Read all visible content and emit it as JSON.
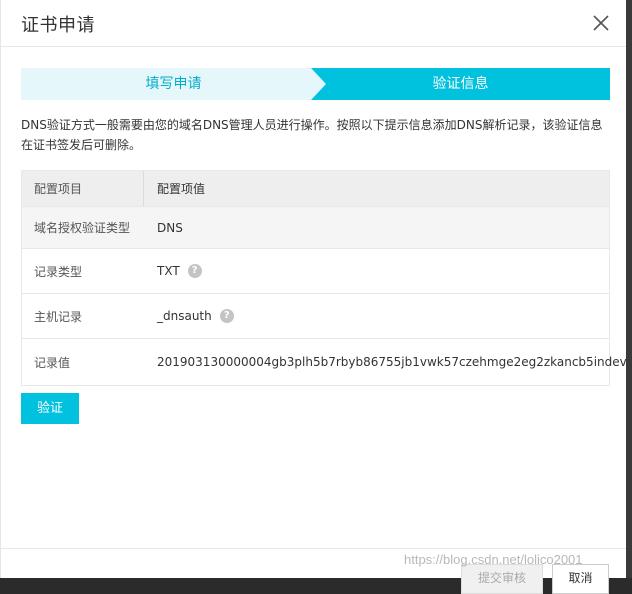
{
  "dialog": {
    "title": "证书申请"
  },
  "steps": [
    {
      "label": "填写申请",
      "active": false
    },
    {
      "label": "验证信息",
      "active": true
    }
  ],
  "description": "DNS验证方式一般需要由您的域名DNS管理人员进行操作。按照以下提示信息添加DNS解析记录，该验证信息在证书签发后可删除。",
  "table": {
    "headers": [
      "配置项目",
      "配置项值"
    ],
    "rows": [
      {
        "key": "域名授权验证类型",
        "value": "DNS",
        "help": false
      },
      {
        "key": "记录类型",
        "value": "TXT",
        "help": true
      },
      {
        "key": "主机记录",
        "value": "_dnsauth",
        "help": true
      },
      {
        "key": "记录值",
        "value": "201903130000004gb3plh5b7rbyb86755jb1vwk57czehmge2eg2zkancb5indev",
        "help": true
      }
    ],
    "help_glyph": "?"
  },
  "buttons": {
    "verify": "验证",
    "submit": "提交审核",
    "cancel": "取消"
  },
  "watermark": "https://blog.csdn.net/lolico2001",
  "colors": {
    "accent": "#00c1de",
    "step_active": "#00c1de",
    "step_inactive": "#e5f7fb",
    "step_inactive_text": "#00aecc"
  }
}
